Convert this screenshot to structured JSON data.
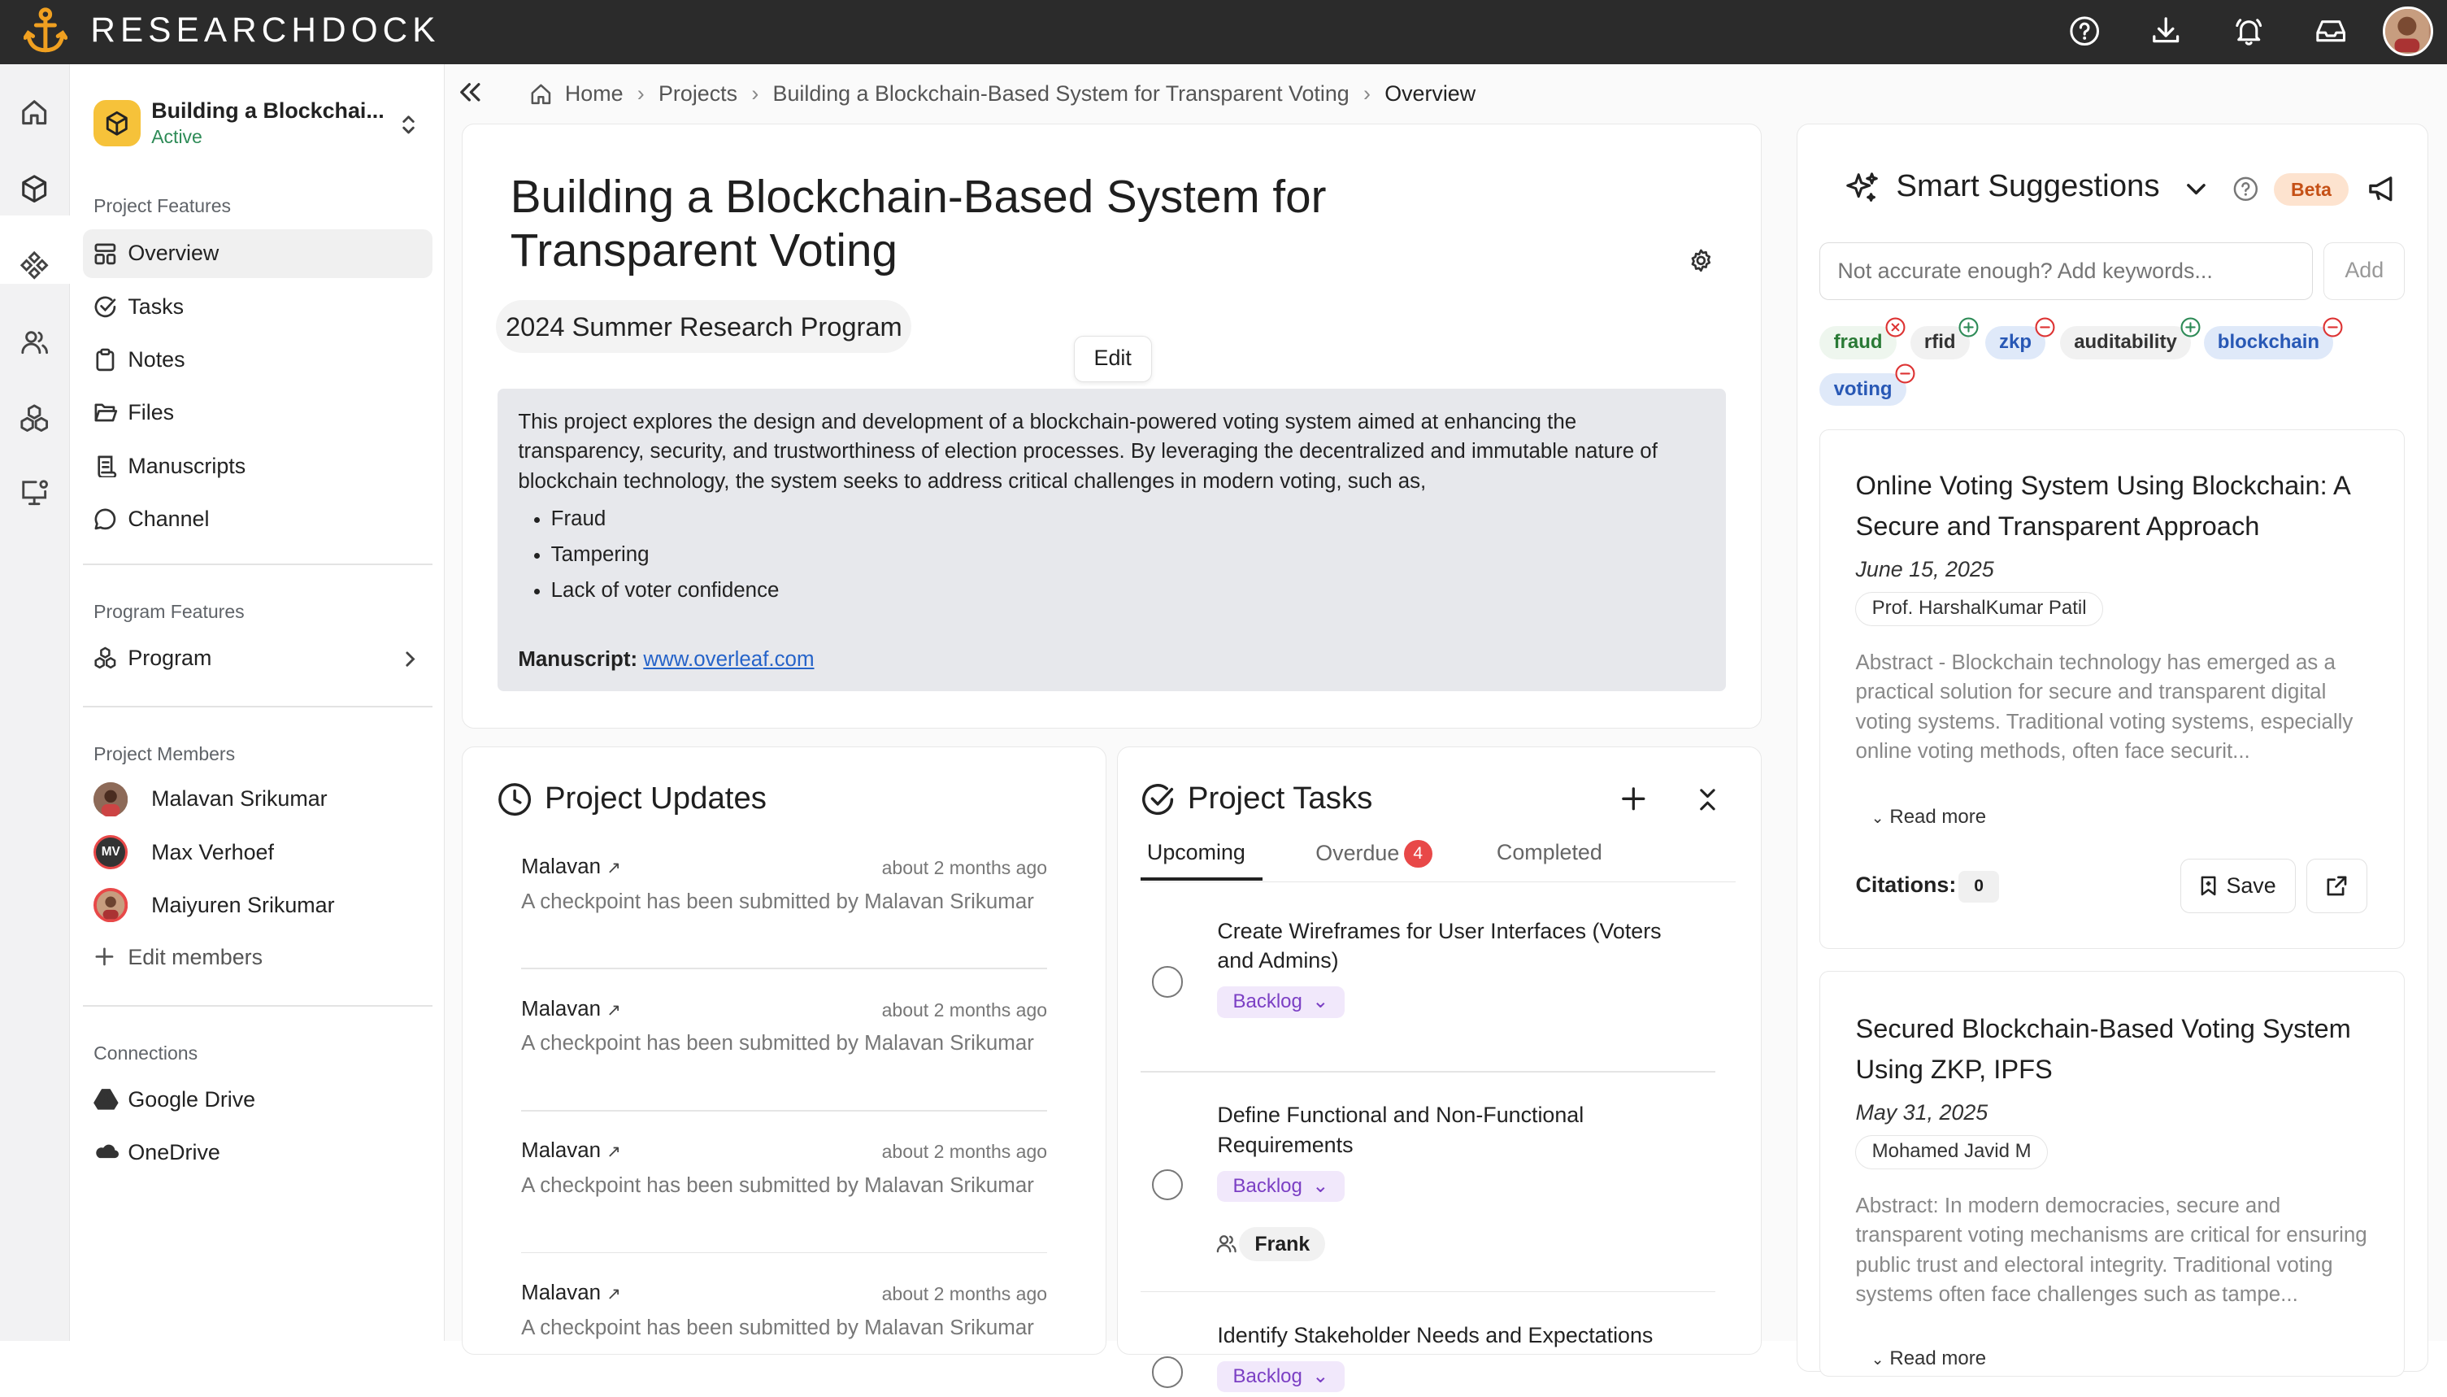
{
  "app": {
    "brand": "RESEARCHDOCK"
  },
  "project": {
    "name": "Building a Blockchai...",
    "status": "Active"
  },
  "sidebar": {
    "project_features_label": "Project Features",
    "nav": [
      "Overview",
      "Tasks",
      "Notes",
      "Files",
      "Manuscripts",
      "Channel"
    ],
    "program_features_label": "Program Features",
    "program_label": "Program",
    "members_label": "Project Members",
    "members": [
      {
        "name": "Malavan Srikumar",
        "initials": ""
      },
      {
        "name": "Max Verhoef",
        "initials": "MV"
      },
      {
        "name": "Maiyuren Srikumar",
        "initials": ""
      }
    ],
    "edit_members": "Edit members",
    "connections_label": "Connections",
    "connections": [
      "Google Drive",
      "OneDrive"
    ]
  },
  "breadcrumb": [
    "Home",
    "Projects",
    "Building a Blockchain-Based System for Transparent Voting",
    "Overview"
  ],
  "overview": {
    "title": "Building a Blockchain-Based System for Transparent Voting",
    "program": "2024 Summer Research Program",
    "edit_label": "Edit",
    "description": "This project explores the design and development of a blockchain-powered voting system aimed at enhancing the transparency, security, and trustworthiness of election processes. By leveraging the decentralized and immutable nature of blockchain technology, the system seeks to address critical challenges in modern voting, such as,",
    "bullets": [
      "Fraud",
      "Tampering",
      "Lack of voter confidence"
    ],
    "manuscript_label": "Manuscript:",
    "manuscript_link": "www.overleaf.com"
  },
  "updates": {
    "title": "Project Updates",
    "items": [
      {
        "author": "Malavan",
        "time": "about 2 months ago",
        "message": "A checkpoint has been submitted by Malavan Srikumar"
      },
      {
        "author": "Malavan",
        "time": "about 2 months ago",
        "message": "A checkpoint has been submitted by Malavan Srikumar"
      },
      {
        "author": "Malavan",
        "time": "about 2 months ago",
        "message": "A checkpoint has been submitted by Malavan Srikumar"
      },
      {
        "author": "Malavan",
        "time": "about 2 months ago",
        "message": "A checkpoint has been submitted by Malavan Srikumar"
      }
    ]
  },
  "tasks": {
    "title": "Project Tasks",
    "tabs": {
      "upcoming": "Upcoming",
      "overdue": "Overdue",
      "overdue_count": "4",
      "completed": "Completed"
    },
    "items": [
      {
        "title": "Create Wireframes for User Interfaces (Voters and Admins)",
        "status": "Backlog",
        "assignee": ""
      },
      {
        "title": "Define Functional and Non-Functional Requirements",
        "status": "Backlog",
        "assignee": "Frank"
      },
      {
        "title": "Identify Stakeholder Needs and Expectations",
        "status": "Backlog",
        "assignee": ""
      }
    ]
  },
  "suggestions": {
    "title": "Smart Suggestions",
    "beta": "Beta",
    "input_placeholder": "Not accurate enough? Add keywords...",
    "add_label": "Add",
    "keywords": [
      {
        "label": "fraud",
        "tone": "green",
        "mark": "x"
      },
      {
        "label": "rfid",
        "tone": "neutral",
        "mark": "plus"
      },
      {
        "label": "zkp",
        "tone": "blue",
        "mark": "minus"
      },
      {
        "label": "auditability",
        "tone": "neutral",
        "mark": "plus"
      },
      {
        "label": "blockchain",
        "tone": "blue",
        "mark": "minus"
      },
      {
        "label": "voting",
        "tone": "blue",
        "mark": "minus"
      }
    ],
    "papers": [
      {
        "title": "Online Voting System Using Blockchain: A Secure and Transparent Approach",
        "date": "June 15, 2025",
        "author": "Prof. HarshalKumar Patil",
        "abstract": "Abstract - Blockchain technology has emerged as a practical solution for secure and transparent digital voting systems. Traditional voting systems, especially online voting methods, often face securit...",
        "read_more": "Read more",
        "citations_label": "Citations:",
        "citations": "0",
        "save_label": "Save"
      },
      {
        "title": "Secured Blockchain-Based Voting System Using ZKP, IPFS",
        "date": "May 31, 2025",
        "author": "Mohamed Javid M",
        "abstract": "Abstract: In modern democracies, secure and transparent voting mechanisms are critical for ensuring public trust and electoral integrity. Traditional voting systems often face challenges such as tampe...",
        "read_more": "Read more"
      }
    ]
  },
  "colors": {
    "accent": "#f6c23a",
    "topbar": "#2b2b2b",
    "badge": "#e84848",
    "status_active": "#2e8b57",
    "pill": "#7b3fc4"
  }
}
